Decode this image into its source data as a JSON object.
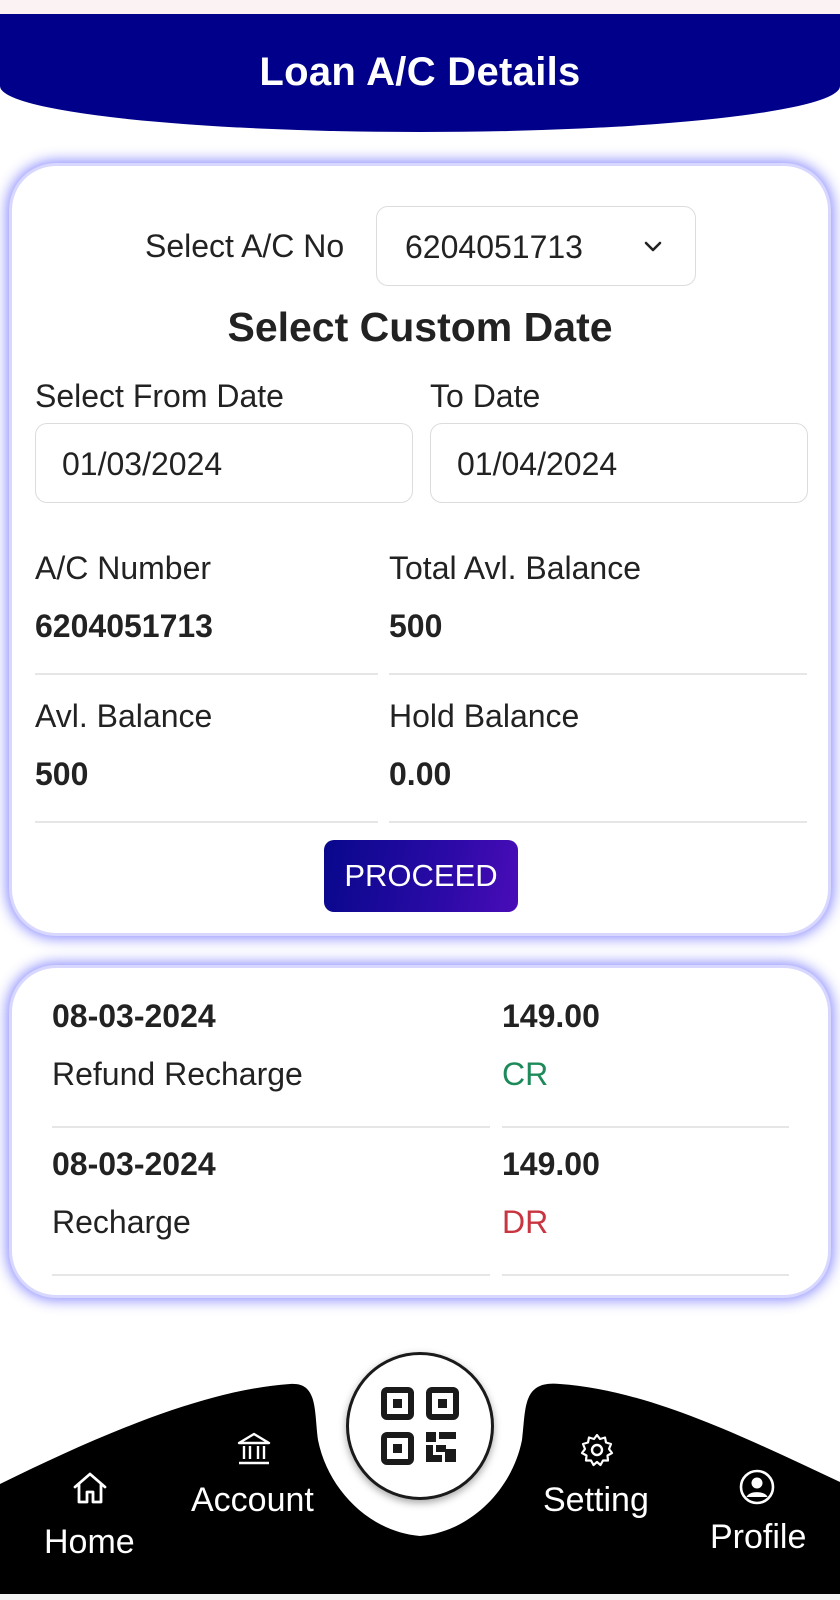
{
  "header": {
    "title": "Loan A/C Details"
  },
  "account_select": {
    "label": "Select A/C No",
    "value": "6204051713"
  },
  "custom_date": {
    "title": "Select Custom Date",
    "from_label": "Select From Date",
    "from_value": "01/03/2024",
    "to_label": "To Date",
    "to_value": "01/04/2024"
  },
  "info": {
    "ac_number_label": "A/C Number",
    "ac_number_value": "6204051713",
    "total_balance_label": "Total Avl. Balance",
    "total_balance_value": "500",
    "avl_balance_label": "Avl. Balance",
    "avl_balance_value": "500",
    "hold_balance_label": "Hold Balance",
    "hold_balance_value": "0.00"
  },
  "proceed_label": "PROCEED",
  "transactions": [
    {
      "date": "08-03-2024",
      "description": "Refund Recharge",
      "amount": "149.00",
      "type": "CR",
      "type_color": "#1e8a5a"
    },
    {
      "date": "08-03-2024",
      "description": "Recharge",
      "amount": "149.00",
      "type": "DR",
      "type_color": "#c8343f"
    }
  ],
  "nav": {
    "home": {
      "label": "Home",
      "icon": "home-icon"
    },
    "account": {
      "label": "Account",
      "icon": "bank-icon"
    },
    "scan": {
      "icon": "qr-code-icon"
    },
    "setting": {
      "label": "Setting",
      "icon": "gear-icon"
    },
    "profile": {
      "label": "Profile",
      "icon": "user-circle-icon"
    }
  },
  "colors": {
    "header_bg": "#00008b",
    "card_glow": "#8787ff",
    "button_gradient_start": "#08088c",
    "button_gradient_end": "#4a0cb8",
    "nav_bg": "#000000"
  }
}
